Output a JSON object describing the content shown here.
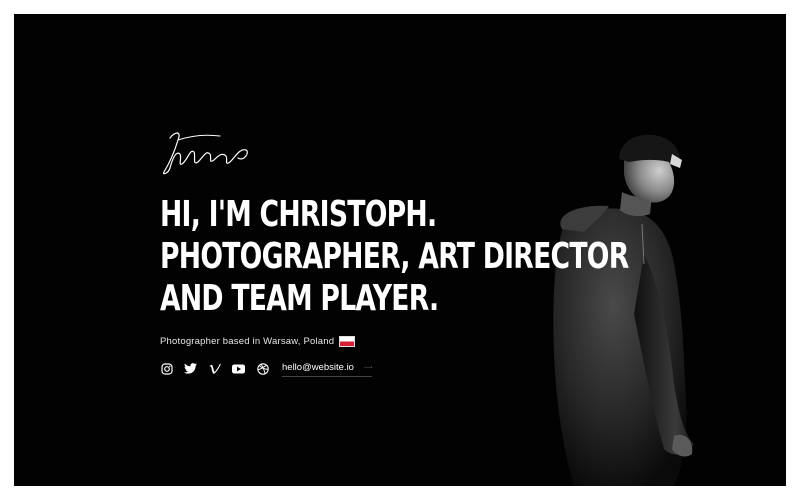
{
  "hero": {
    "headline_lines": [
      "HI, I'M CHRISTOPH.",
      "PHOTOGRAPHER, ART DIRECTOR",
      "AND TEAM PLAYER."
    ],
    "subtitle": "Photographer based in Warsaw, Poland",
    "flag": "poland-flag"
  },
  "social": {
    "icons": [
      "instagram-icon",
      "twitter-icon",
      "vimeo-icon",
      "youtube-icon",
      "dribbble-icon"
    ],
    "email": "hello@website.io"
  },
  "colors": {
    "background": "#020202",
    "text": "#ffffff",
    "flag_red": "#d81e34"
  }
}
